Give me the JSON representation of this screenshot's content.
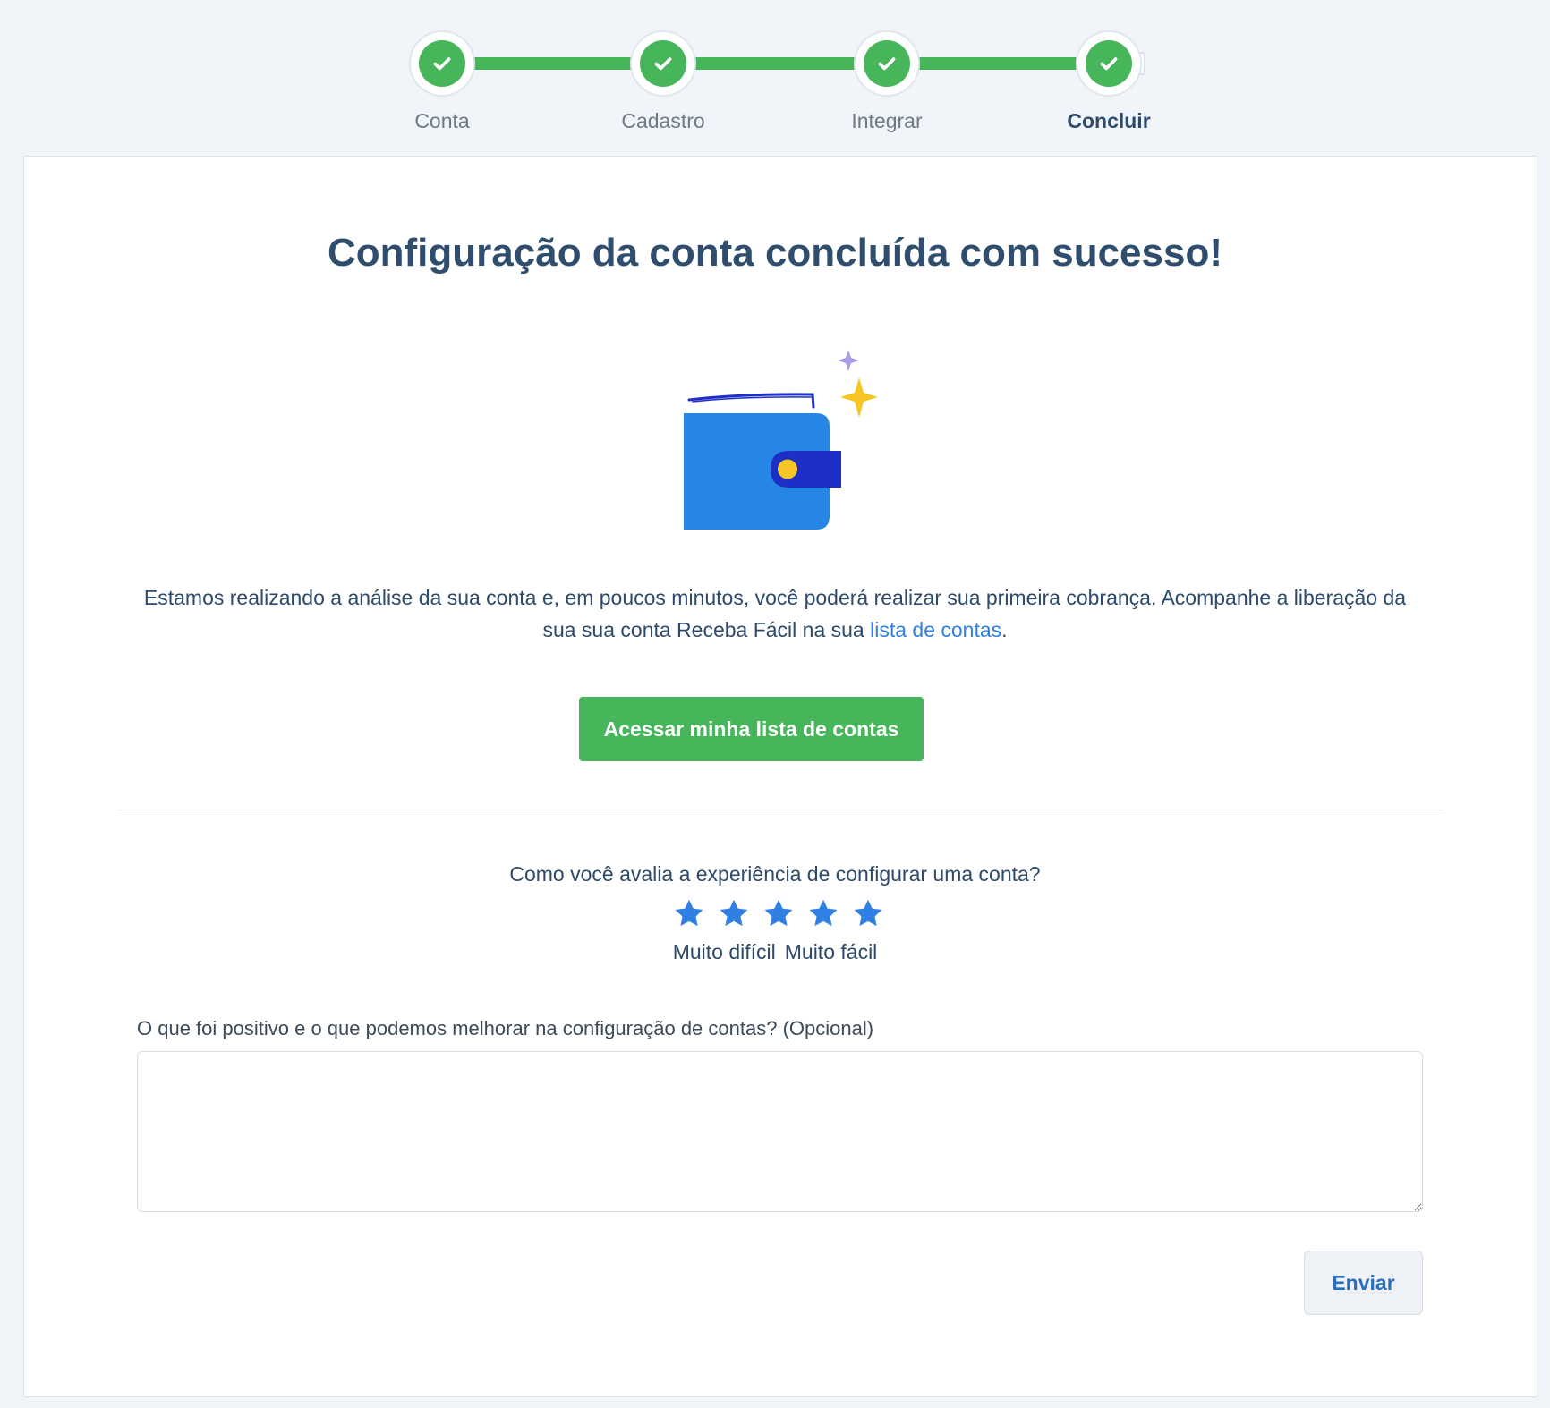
{
  "stepper": {
    "steps": [
      {
        "label": "Conta",
        "status": "completed"
      },
      {
        "label": "Cadastro",
        "status": "completed"
      },
      {
        "label": "Integrar",
        "status": "completed"
      },
      {
        "label": "Concluir",
        "status": "completed-current"
      }
    ],
    "progress_color": "#47b55a"
  },
  "main": {
    "title": "Configuração da conta concluída com sucesso!",
    "illustration_icon": "wallet-icon",
    "description_prefix": "Estamos realizando a análise da sua conta e, em poucos minutos, você poderá realizar sua primeira cobrança. Acompanhe a liberação da sua sua conta Receba Fácil na sua ",
    "description_link": "lista de contas",
    "description_suffix": ".",
    "primary_button": "Acessar minha lista de contas"
  },
  "rating": {
    "question": "Como você avalia a experiência de configurar uma conta?",
    "star_count": 5,
    "star_color": "#2f80e2",
    "min_label": "Muito difícil",
    "max_label": "Muito fácil"
  },
  "feedback": {
    "label": "O que foi positivo e o que podemos melhorar na configuração de contas? (Opcional)",
    "value": "",
    "placeholder": "",
    "submit_label": "Enviar"
  }
}
